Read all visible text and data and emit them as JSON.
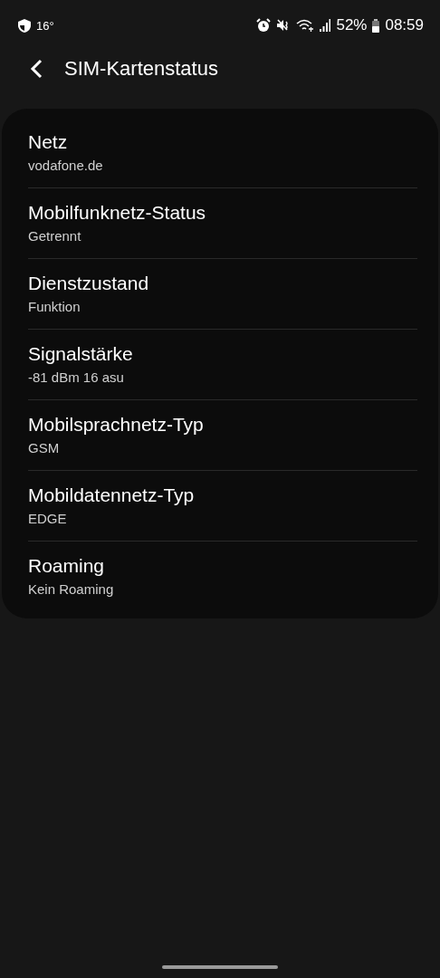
{
  "status_bar": {
    "temperature": "16°",
    "battery_percent": "52%",
    "time": "08:59"
  },
  "header": {
    "title": "SIM-Kartenstatus"
  },
  "items": [
    {
      "title": "Netz",
      "value": "vodafone.de"
    },
    {
      "title": "Mobilfunknetz-Status",
      "value": "Getrennt"
    },
    {
      "title": "Dienstzustand",
      "value": "Funktion"
    },
    {
      "title": "Signalstärke",
      "value": "-81 dBm 16 asu"
    },
    {
      "title": "Mobilsprachnetz-Typ",
      "value": "GSM"
    },
    {
      "title": "Mobildatennetz-Typ",
      "value": "EDGE"
    },
    {
      "title": "Roaming",
      "value": "Kein Roaming"
    }
  ]
}
